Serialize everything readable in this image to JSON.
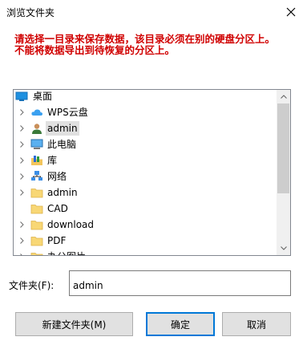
{
  "window": {
    "title": "浏览文件夹",
    "close_icon": "close-icon"
  },
  "warning": {
    "line1": "请选择一目录来保存数据，该目录必须在别的硬盘分区上。",
    "line2": "不能将数据导出到待恢复的分区上。",
    "color": "#d00000"
  },
  "tree": {
    "items": [
      {
        "label": "桌面",
        "icon": "desktop-icon",
        "expandable": false,
        "selected": false
      },
      {
        "label": "WPS云盘",
        "icon": "cloud-icon",
        "expandable": true,
        "selected": false
      },
      {
        "label": "admin",
        "icon": "user-icon",
        "expandable": true,
        "selected": true
      },
      {
        "label": "此电脑",
        "icon": "computer-icon",
        "expandable": true,
        "selected": false
      },
      {
        "label": "库",
        "icon": "library-icon",
        "expandable": true,
        "selected": false
      },
      {
        "label": "网络",
        "icon": "network-icon",
        "expandable": true,
        "selected": false
      },
      {
        "label": "admin",
        "icon": "folder-icon",
        "expandable": true,
        "selected": false
      },
      {
        "label": "CAD",
        "icon": "folder-icon",
        "expandable": false,
        "selected": false
      },
      {
        "label": "download",
        "icon": "folder-icon",
        "expandable": true,
        "selected": false
      },
      {
        "label": "PDF",
        "icon": "folder-icon",
        "expandable": true,
        "selected": false
      },
      {
        "label": "办公图片",
        "icon": "folder-icon",
        "expandable": true,
        "selected": false
      }
    ]
  },
  "folder_field": {
    "label": "文件夹(F):",
    "value": "admin"
  },
  "buttons": {
    "new_folder": "新建文件夹(M)",
    "ok": "确定",
    "cancel": "取消"
  }
}
